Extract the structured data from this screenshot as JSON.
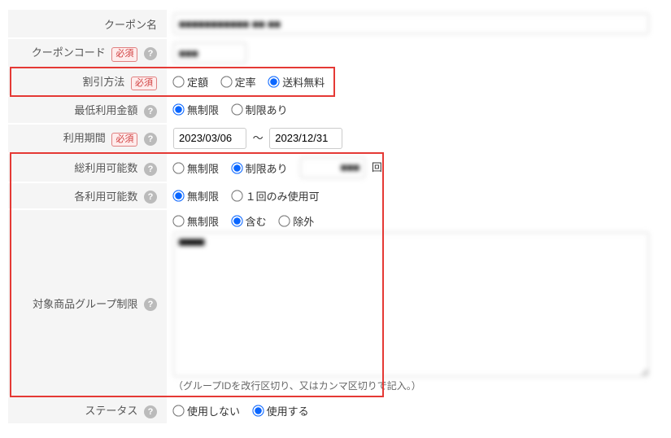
{
  "labels": {
    "coupon_name": "クーポン名",
    "coupon_code": "クーポンコード",
    "discount_method": "割引方法",
    "min_amount": "最低利用金額",
    "period": "利用期間",
    "total_uses": "総利用可能数",
    "user_uses": "各利用可能数",
    "product_group": "対象商品グループ制限",
    "status": "ステータス"
  },
  "required_badge": "必須",
  "values": {
    "coupon_name": "■■■■■■■■■■■ ■■ ■■",
    "coupon_code": "■■■",
    "period_from": "2023/03/06",
    "period_to": "2023/12/31",
    "total_limit_value": "■■■",
    "product_group_text": "■■■■"
  },
  "options": {
    "discount": {
      "fixed": "定額",
      "rate": "定率",
      "free_ship": "送料無料"
    },
    "min_amount": {
      "unlimited": "無制限",
      "limited": "制限あり"
    },
    "total_uses": {
      "unlimited": "無制限",
      "limited": "制限あり",
      "suffix": "回"
    },
    "user_uses": {
      "unlimited": "無制限",
      "once": "１回のみ使用可"
    },
    "product_group": {
      "unlimited": "無制限",
      "include": "含む",
      "exclude": "除外"
    },
    "status": {
      "off": "使用しない",
      "on": "使用する"
    }
  },
  "hint_product_group": "（グループIDを改行区切り、又はカンマ区切りで記入。）",
  "date_range_sep": "〜"
}
